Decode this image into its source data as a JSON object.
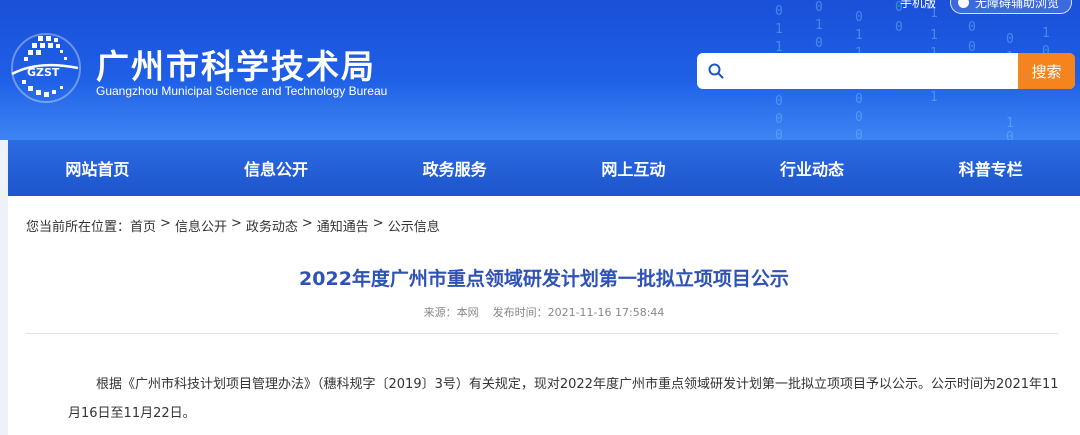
{
  "site": {
    "title": "广州市科学技术局",
    "subtitle": "Guangzhou Municipal Science and Technology Bureau",
    "logo_text": "GZST"
  },
  "top_links": {
    "text": "手机版",
    "pill": "无障碍辅助浏览"
  },
  "search": {
    "placeholder": "",
    "value": "",
    "button_label": "搜索"
  },
  "nav": {
    "items": [
      "网站首页",
      "信息公开",
      "政务服务",
      "网上互动",
      "行业动态",
      "科普专栏"
    ]
  },
  "breadcrumb": {
    "prefix": "您当前所在位置：",
    "items": [
      "首页",
      "信息公开",
      "政务动态",
      "通知通告",
      "公示信息"
    ],
    "separator": ">"
  },
  "article": {
    "title": "2022年度广州市重点领域研发计划第一批拟立项项目公示",
    "source_label": "来源：本网",
    "time_label": "发布时间：",
    "time_value": "2021-11-16 17:58:44",
    "body": "根据《广州市科技计划项目管理办法》（穗科规字〔2019〕3号）有关规定，现对2022年度广州市重点领域研发计划第一批拟立项项目予以公示。公示时间为2021年11月16日至11月22日。"
  },
  "colors": {
    "banner": "#1e5fe6",
    "nav": "#1d55cc",
    "search_button": "#f5841f",
    "title": "#2f52b5"
  }
}
